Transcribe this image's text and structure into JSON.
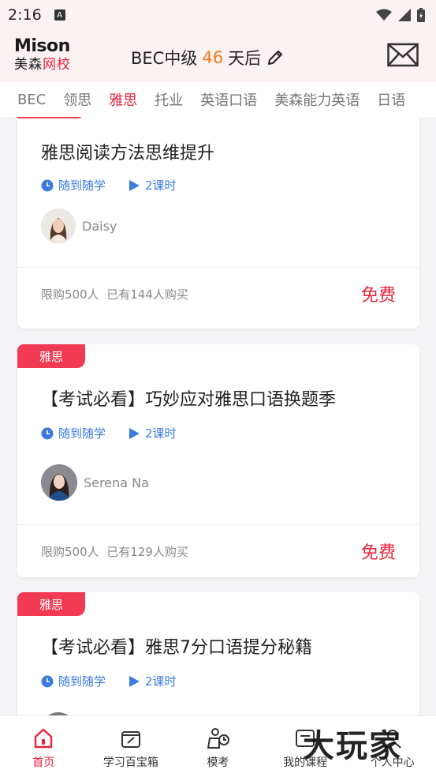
{
  "status_bar": {
    "time": "2:16",
    "notif_icon": "A"
  },
  "header": {
    "logo_top": "Mison",
    "logo_bottom_1": "美森",
    "logo_bottom_2": "网校",
    "countdown_prefix": "BEC中级",
    "countdown_days": "46",
    "countdown_suffix": "天后"
  },
  "tabs": [
    "BEC",
    "领思",
    "雅思",
    "托业",
    "英语口语",
    "美森能力英语",
    "日语"
  ],
  "active_tab": 2,
  "courses": [
    {
      "badge": "",
      "title": "雅思阅读方法思维提升",
      "mode": "随到随学",
      "lessons": "2课时",
      "teacher": "Daisy",
      "limit": "限购500人",
      "bought": "已有144人购买",
      "price": "免费"
    },
    {
      "badge": "雅思",
      "title": "【考试必看】巧妙应对雅思口语换题季",
      "mode": "随到随学",
      "lessons": "2课时",
      "teacher": "Serena Na",
      "limit": "限购500人",
      "bought": "已有129人购买",
      "price": "免费"
    },
    {
      "badge": "雅思",
      "title": "【考试必看】雅思7分口语提分秘籍",
      "mode": "随到随学",
      "lessons": "2课时",
      "teacher": "",
      "limit": "",
      "bought": "",
      "price": ""
    }
  ],
  "bottom_nav": [
    {
      "label": "首页",
      "icon": "home-icon"
    },
    {
      "label": "学习百宝箱",
      "icon": "toolbox-icon"
    },
    {
      "label": "模考",
      "icon": "exam-icon"
    },
    {
      "label": "我的课程",
      "icon": "course-icon"
    },
    {
      "label": "个人中心",
      "icon": "profile-icon"
    }
  ],
  "watermark": "大玩家",
  "colors": {
    "accent": "#e8233c",
    "badge": "#f23a52",
    "meta_blue": "#3b7be0",
    "countdown": "#f07b1a"
  }
}
